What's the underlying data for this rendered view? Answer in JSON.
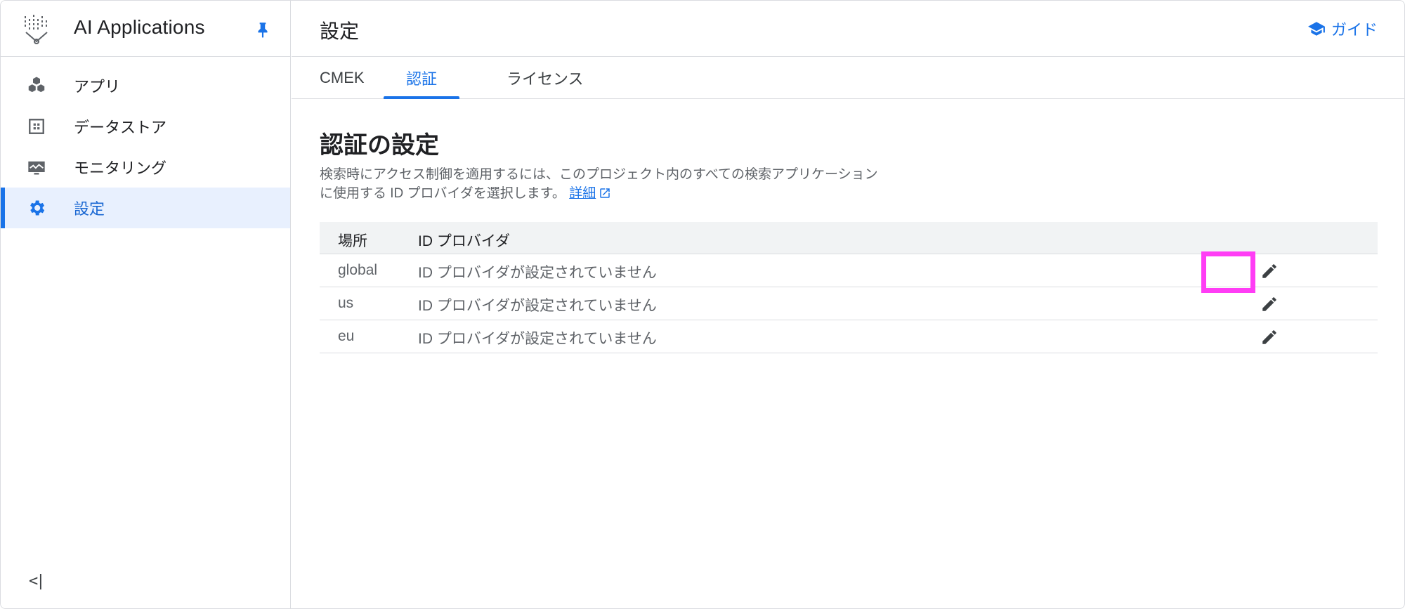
{
  "sidebar": {
    "app_title": "AI Applications",
    "items": [
      {
        "label": "アプリ",
        "icon": "cubes-icon"
      },
      {
        "label": "データストア",
        "icon": "datastore-icon"
      },
      {
        "label": "モニタリング",
        "icon": "monitoring-icon"
      },
      {
        "label": "設定",
        "icon": "gear-icon"
      }
    ],
    "active_index": 3,
    "collapse_label": "<|"
  },
  "header": {
    "title": "設定",
    "guide_label": "ガイド"
  },
  "tabs": [
    {
      "label": "CMEK"
    },
    {
      "label": "認証"
    },
    {
      "label": "ライセンス"
    }
  ],
  "active_tab": 1,
  "section": {
    "title": "認証の設定",
    "desc_line1": "検索時にアクセス制御を適用するには、このプロジェクト内のすべての検索アプリケーション",
    "desc_line2": "に使用する ID プロバイダを選択します。",
    "more_link": "詳細"
  },
  "table": {
    "headers": {
      "location": "場所",
      "idp": "ID プロバイダ"
    },
    "rows": [
      {
        "location": "global",
        "idp": "ID プロバイダが設定されていません"
      },
      {
        "location": "us",
        "idp": "ID プロバイダが設定されていません"
      },
      {
        "location": "eu",
        "idp": "ID プロバイダが設定されていません"
      }
    ]
  },
  "colors": {
    "accent": "#1a73e8",
    "active_bg": "#e8f0fe",
    "highlight": "#ff3df5"
  }
}
